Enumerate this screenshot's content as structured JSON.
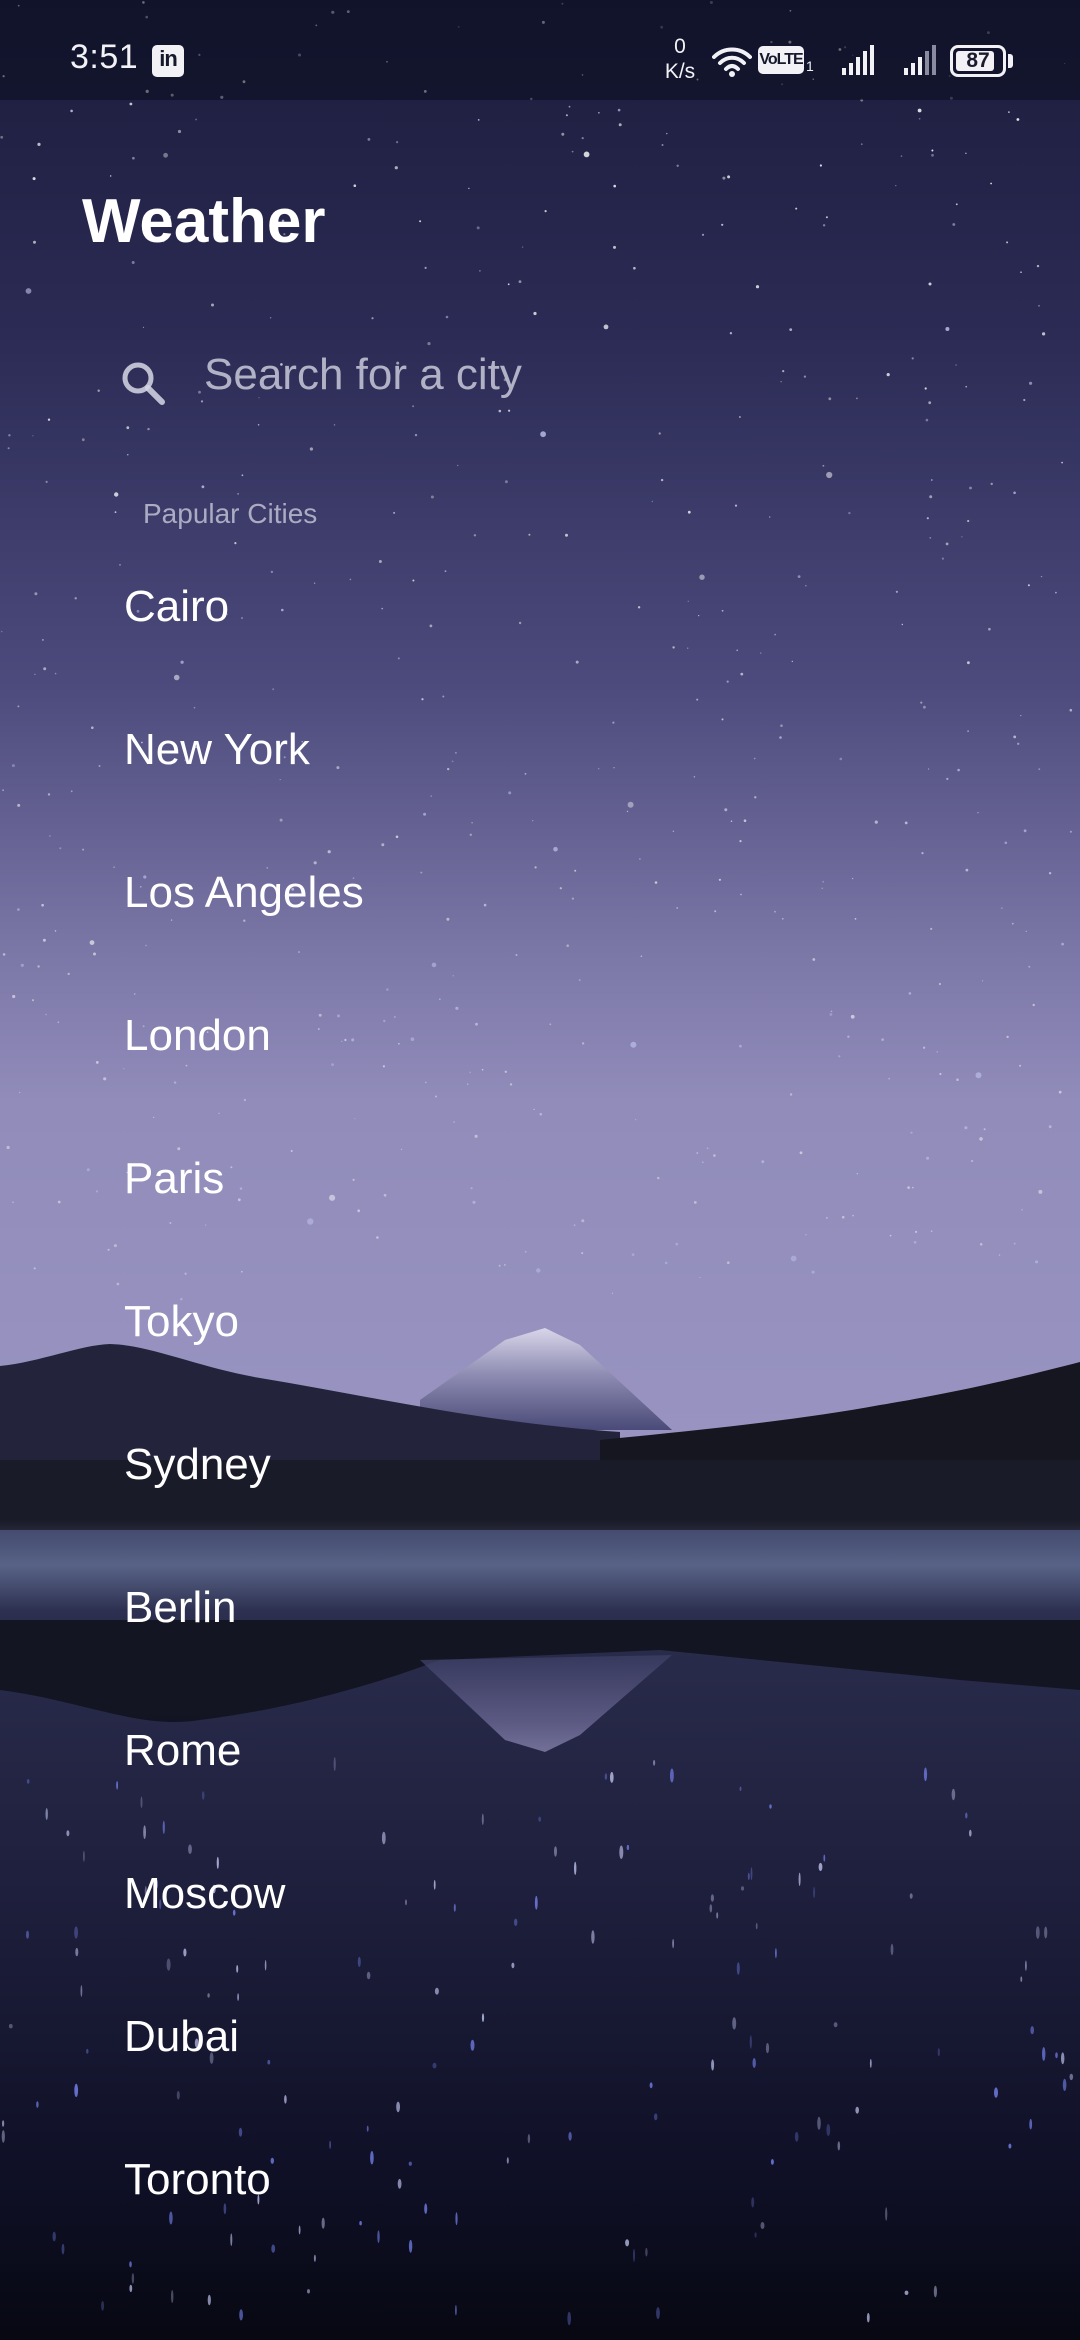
{
  "status_bar": {
    "time": "3:51",
    "notification_icon": "linkedin-icon",
    "notification_icon_text": "in",
    "net_speed_value": "0",
    "net_speed_unit": "K/s",
    "volte_label": "VoLTE",
    "sim_number": "1",
    "battery_level": "87",
    "battery_fraction": 0.87
  },
  "header": {
    "title": "Weather"
  },
  "search": {
    "placeholder": "Search for a city",
    "value": "",
    "icon": "search-icon"
  },
  "popular": {
    "label": "Papular Cities",
    "cities": [
      "Cairo",
      "New York",
      "Los Angeles",
      "London",
      "Paris",
      "Tokyo",
      "Sydney",
      "Berlin",
      "Rome",
      "Moscow",
      "Dubai",
      "Toronto"
    ]
  },
  "colors": {
    "text": "#ffffff",
    "muted_text": "#d7d7e6",
    "sky_top": "#1c1c3c",
    "sky_horizon": "#8d88b6",
    "water": "#0b0c1c"
  }
}
